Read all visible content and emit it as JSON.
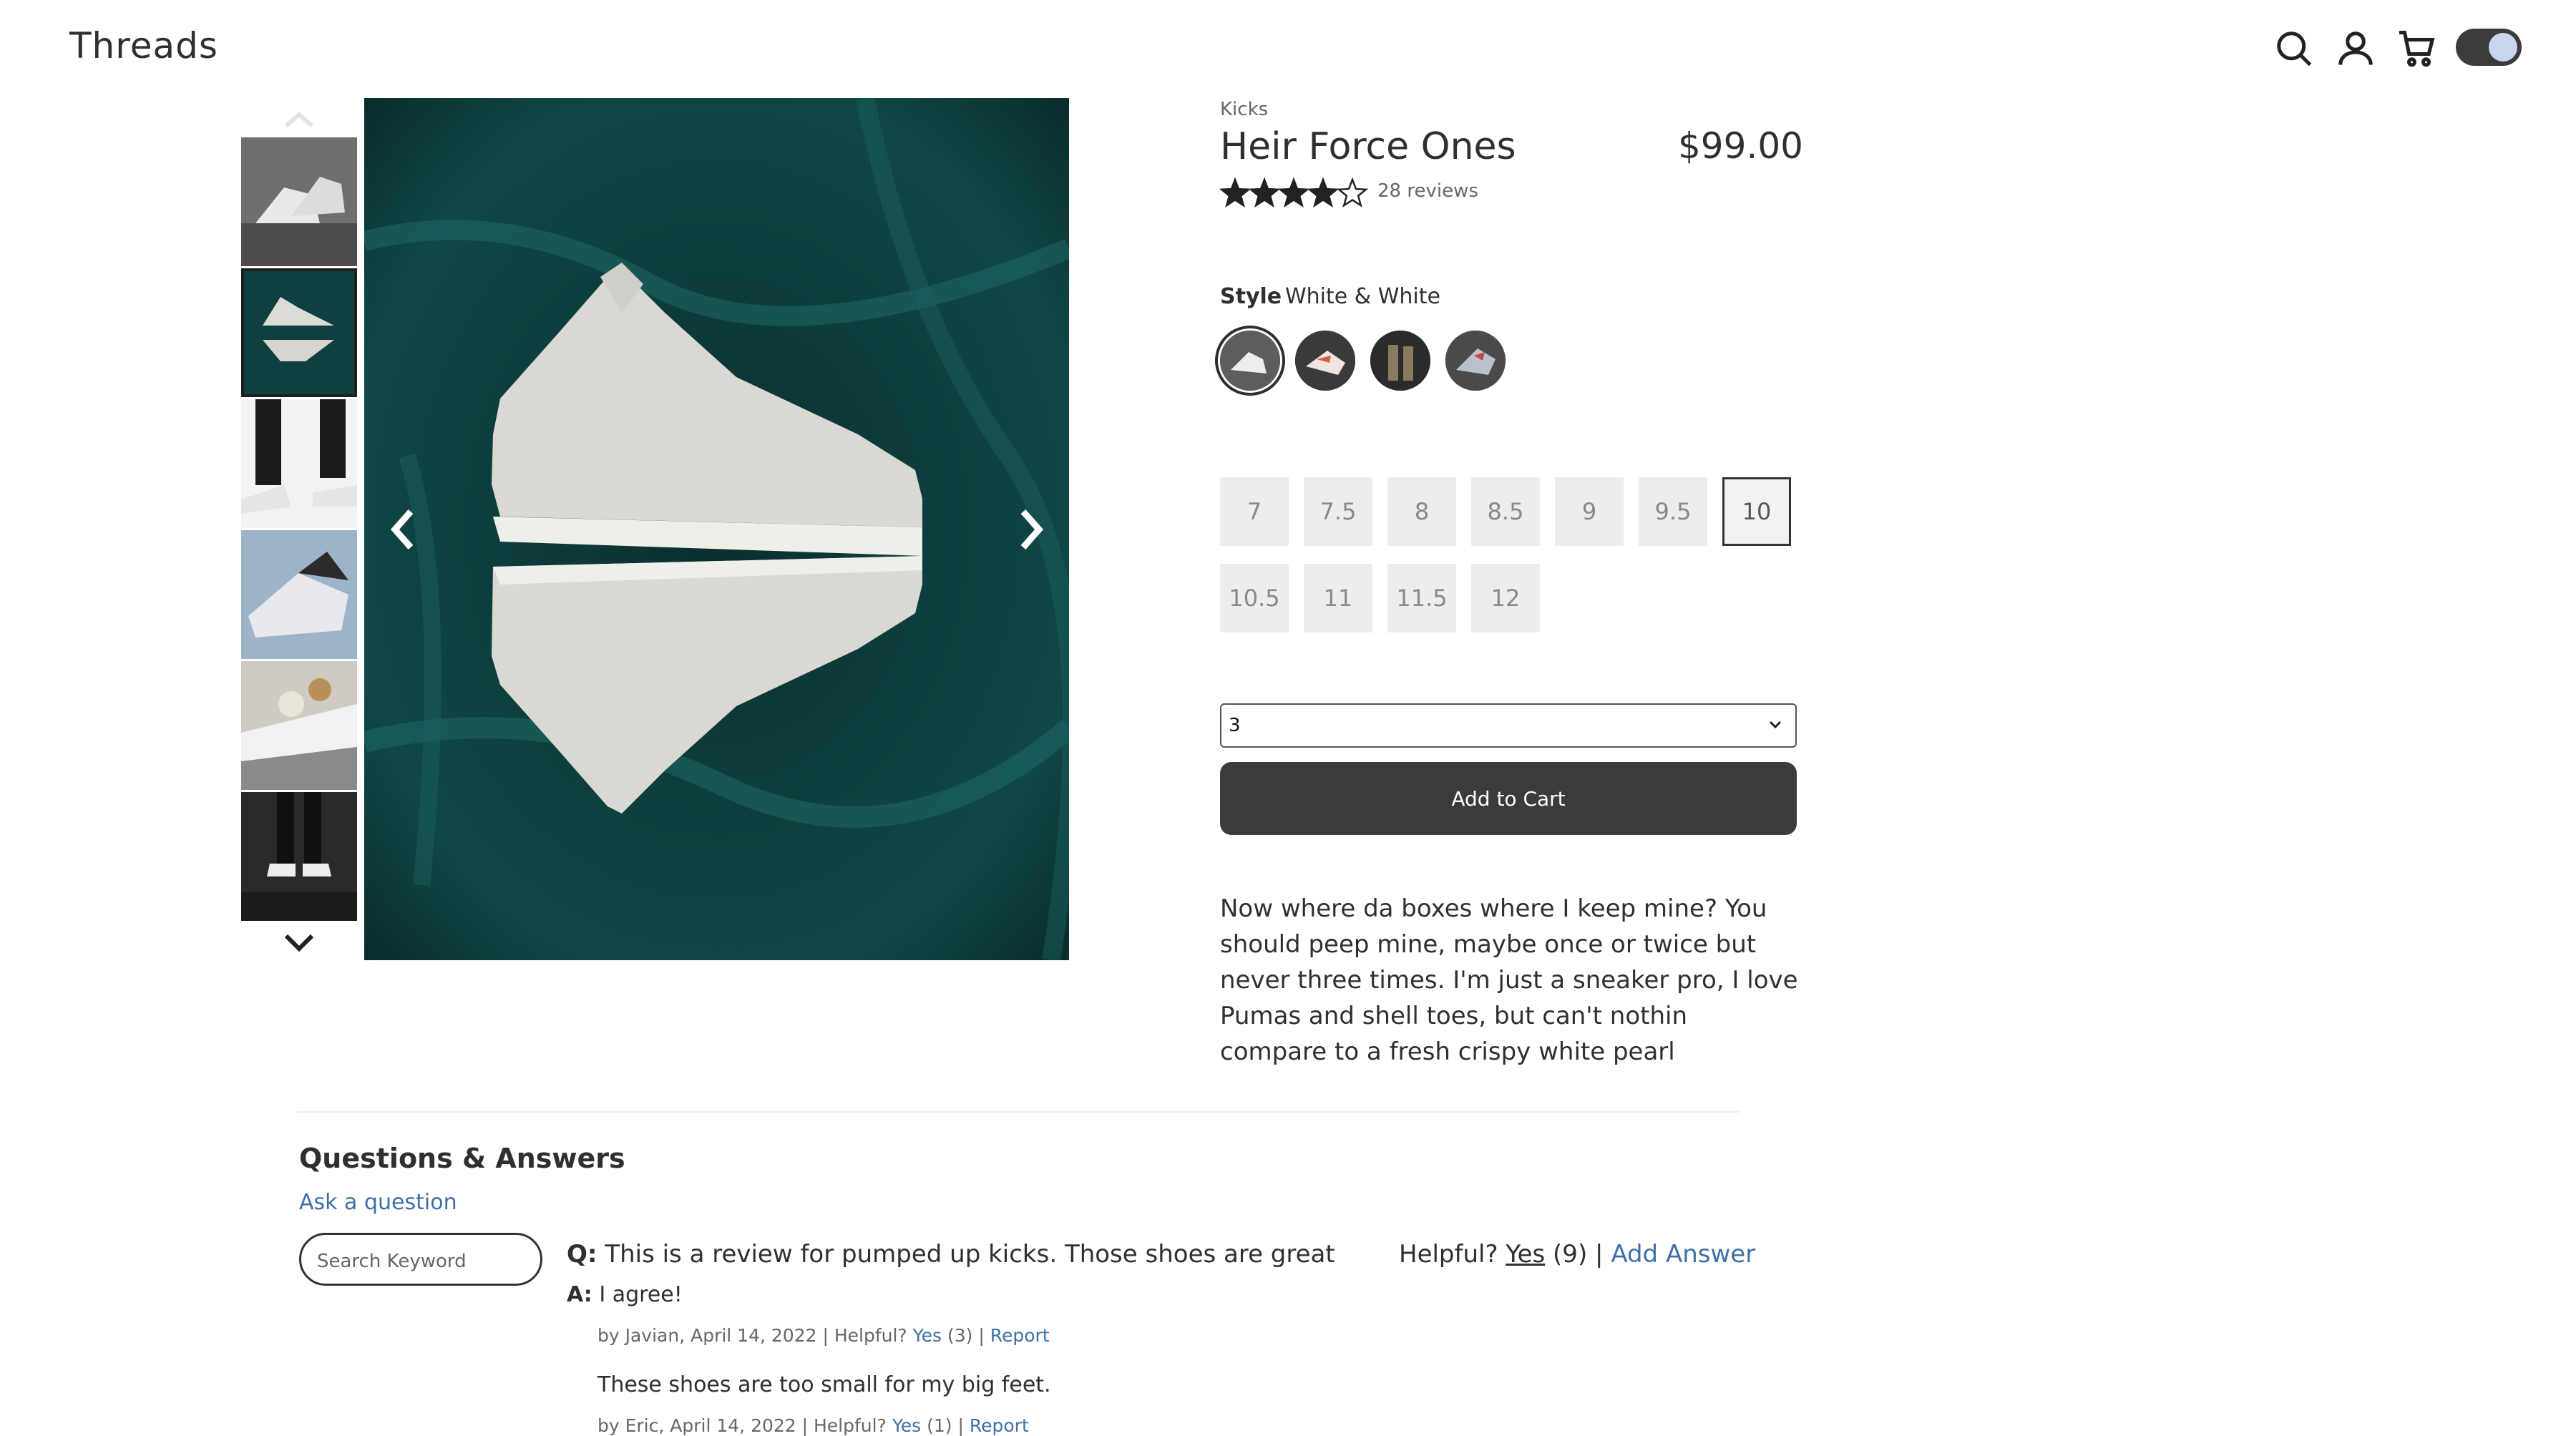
{
  "header": {
    "logo": "Threads",
    "icons": [
      "search-icon",
      "user-icon",
      "cart-icon"
    ],
    "theme_toggle": "on"
  },
  "gallery": {
    "thumbnails": [
      "thumb-1",
      "thumb-2",
      "thumb-3",
      "thumb-4",
      "thumb-5",
      "thumb-6"
    ],
    "selected_index": 1
  },
  "product": {
    "category": "Kicks",
    "name": "Heir Force Ones",
    "price": "$99.00",
    "rating": 4,
    "reviews": "28 reviews",
    "style_label": "Style",
    "style_value": "White & White",
    "sizes": [
      "7",
      "7.5",
      "8",
      "8.5",
      "9",
      "9.5",
      "10",
      "10.5",
      "11",
      "11.5",
      "12"
    ],
    "selected_size": "10",
    "quantity": "3",
    "add_to_cart": "Add to Cart",
    "description": "Now where da boxes where I keep mine? You should peep mine, maybe once or twice but never three times. I'm just a sneaker pro, I love Pumas and shell toes, but can't nothin compare to a fresh crispy white pearl"
  },
  "qa": {
    "title": "Questions & Answers",
    "ask": "Ask a question",
    "search_placeholder": "Search Keyword",
    "question": {
      "prefix": "Q:",
      "text": "This is a review for pumped up kicks. Those shoes are great",
      "helpful_label": "Helpful?",
      "yes": "Yes",
      "count": "(9)",
      "sep": "|",
      "add_answer": "Add Answer"
    },
    "answers": [
      {
        "prefix": "A:",
        "text": "I agree!",
        "by": "by Javian, April 14, 2022 | Helpful?",
        "yes": "Yes",
        "count": "(3) |",
        "report": "Report"
      },
      {
        "text": "These shoes are too small for my big feet.",
        "by": "by Eric, April 14, 2022 | Helpful?",
        "yes": "Yes",
        "count": "(1) |",
        "report": "Report"
      }
    ]
  },
  "colors": {
    "accent_link": "#3f6fa6",
    "dark_button": "#3b3b3b",
    "image_bg": "#0e3b3a"
  }
}
